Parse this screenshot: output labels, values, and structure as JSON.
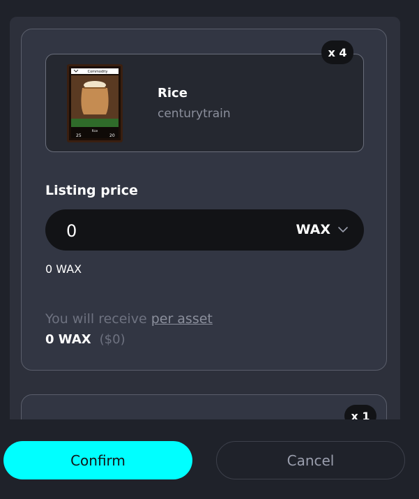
{
  "listing": {
    "quantity_badge": "x 4",
    "asset": {
      "name": "Rice",
      "collection": "centurytrain",
      "card": {
        "header": "Commodity",
        "title": "Rice",
        "left_stat": "25",
        "right_stat": "20"
      }
    },
    "price_label": "Listing price",
    "price_value": "0",
    "currency": "WAX",
    "price_echo": "0 WAX",
    "receive_prefix": "You will receive ",
    "receive_link": "per asset",
    "receive_amount": "0 WAX",
    "receive_fiat": "($0)"
  },
  "second_listing": {
    "quantity_badge": "x 1"
  },
  "footer": {
    "confirm_label": "Confirm",
    "cancel_label": "Cancel"
  },
  "colors": {
    "accent": "#00ffff",
    "panel": "#2d303b",
    "background": "#1f222a"
  },
  "icons": {
    "currency_dropdown": "chevron-down-icon"
  }
}
